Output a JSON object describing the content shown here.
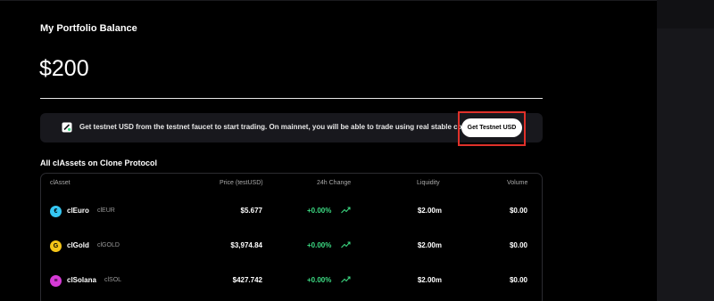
{
  "portfolio": {
    "title": "My Portfolio Balance",
    "balance": "$200"
  },
  "faucet_banner": {
    "message": "Get testnet USD from the testnet faucet to start trading. On mainnet, you will be able to trade using real stable coin.",
    "button_label": "Get Testnet USD"
  },
  "assets_section": {
    "title": "All clAssets on Clone Protocol",
    "columns": {
      "asset": "clAsset",
      "price": "Price (testUSD)",
      "change": "24h Change",
      "liquidity": "Liquidity",
      "volume": "Volume"
    },
    "rows": [
      {
        "name": "clEuro",
        "ticker": "clEUR",
        "price": "$5.677",
        "change": "+0.00%",
        "liquidity": "$2.00m",
        "volume": "$0.00",
        "icon": "euro-coin-icon",
        "icon_glyph": "€",
        "icon_color": "#35c6f2"
      },
      {
        "name": "clGold",
        "ticker": "clGOLD",
        "price": "$3,974.84",
        "change": "+0.00%",
        "liquidity": "$2.00m",
        "volume": "$0.00",
        "icon": "gold-coin-icon",
        "icon_glyph": "G",
        "icon_color": "#f5c518"
      },
      {
        "name": "clSolana",
        "ticker": "clSOL",
        "price": "$427.742",
        "change": "+0.00%",
        "liquidity": "$2.00m",
        "volume": "$0.00",
        "icon": "solana-coin-icon",
        "icon_glyph": "≡",
        "icon_color": "#d63ad6"
      }
    ]
  },
  "colors": {
    "positive": "#3ddc84",
    "highlight_box": "#e0312a",
    "background": "#000000",
    "banner_bg": "#18181d"
  }
}
